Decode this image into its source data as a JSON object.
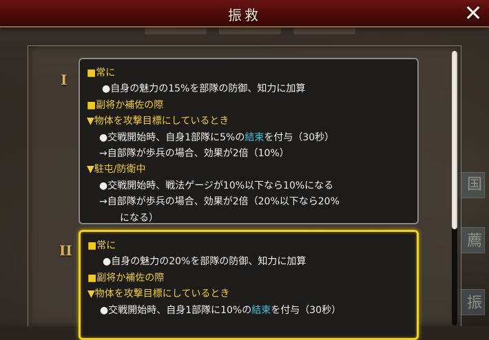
{
  "window": {
    "title": "振救",
    "close_glyph": "✕"
  },
  "scroll": {
    "position_fraction": 0.0,
    "visible_fraction": 0.65
  },
  "levels": [
    {
      "numeral": "I",
      "sections": {
        "always_label": "常に",
        "always_text": "●自身の魅力の15%を部隊の防御、知力に加算",
        "aide_label": "副将か補佐の際",
        "attack_label": "▼物体を攻撃目標にしているとき",
        "attack_pre": "●交戦開始時、自身1部隊に5%の",
        "attack_kw": "結束",
        "attack_post": "を付与（30秒）",
        "attack_note": "→自部隊が歩兵の場合、効果が2倍（10%）",
        "garrison_label": "▼駐屯/防衛中",
        "garrison_text": "●交戦開始時、戦法ゲージが10%以下なら10%になる",
        "garrison_note": "→自部隊が歩兵の場合、効果が2倍（20%以下なら20%",
        "garrison_note_cont": "になる）"
      }
    },
    {
      "numeral": "II",
      "sections": {
        "always_label": "常に",
        "always_text": "●自身の魅力の20%を部隊の防御、知力に加算",
        "aide_label": "副将か補佐の際",
        "attack_label": "▼物体を攻撃目標にしているとき",
        "attack_pre": "●交戦開始時、自身1部隊に10%の",
        "attack_kw": "結束",
        "attack_post": "を付与（30秒）"
      }
    }
  ],
  "colors": {
    "header": "#f0cc3a",
    "keyword": "#3cc3dc",
    "selected_border": "#f0d21a"
  }
}
